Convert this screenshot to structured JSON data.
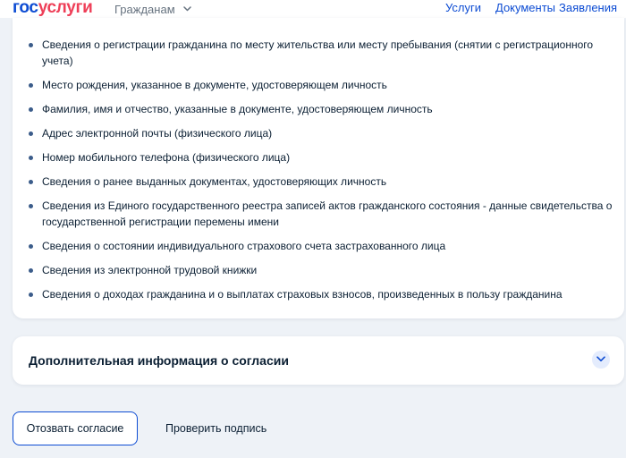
{
  "header": {
    "logo_part1": "гос",
    "logo_part2": "услуги",
    "audience_label": "Гражданам",
    "nav": [
      "Услуги",
      "Документы",
      "Заявления"
    ]
  },
  "consent_items": [
    "Сведения о регистрации гражданина по месту жительства или месту пребывания (снятии с регистрационного учета)",
    "Место рождения, указанное в документе, удостоверяющем личность",
    "Фамилия, имя и отчество, указанные в документе, удостоверяющем личность",
    "Адрес электронной почты (физического лица)",
    "Номер мобильного телефона (физического лица)",
    "Сведения о ранее выданных документах, удостоверяющих личность",
    "Сведения из Единого государственного реестра записей актов гражданского состояния - данные свидетельства о государственной регистрации перемены имени",
    "Сведения о состоянии индивидуального страхового счета застрахованного лица",
    "Сведения из электронной трудовой книжки",
    "Сведения о доходах гражданина и о выплатах страховых взносов, произведенных в пользу гражданина"
  ],
  "additional_info": {
    "title": "Дополнительная информация о согласии"
  },
  "actions": {
    "revoke_label": "Отозвать согласие",
    "check_signature_label": "Проверить подпись"
  },
  "icons": {
    "audience": "chevron-down-icon",
    "expand": "chevron-down-icon",
    "bullet": "bullet-icon"
  },
  "colors": {
    "brand_blue": "#0d4cd3",
    "brand_red": "#ee3f58",
    "text": "#0b1f33",
    "background": "#eef2f7",
    "bullet": "#3b5c8a"
  }
}
